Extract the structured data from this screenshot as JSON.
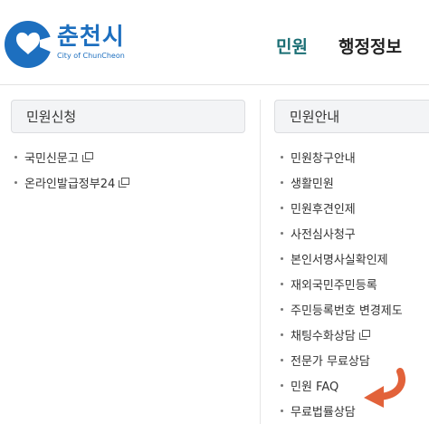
{
  "header": {
    "logo_name": "춘천시",
    "logo_sub": "City of ChunCheon",
    "nav": [
      {
        "label": "민원"
      },
      {
        "label": "행정정보"
      }
    ]
  },
  "left_column": {
    "title": "민원신청",
    "items": [
      {
        "label": "국민신문고",
        "external": true
      },
      {
        "label": "온라인발급정부24",
        "external": true
      }
    ]
  },
  "right_column": {
    "title": "민원안내",
    "items": [
      {
        "label": "민원창구안내",
        "external": false
      },
      {
        "label": "생활민원",
        "external": false
      },
      {
        "label": "민원후견인제",
        "external": false
      },
      {
        "label": "사전심사청구",
        "external": false
      },
      {
        "label": "본인서명사실확인제",
        "external": false
      },
      {
        "label": "재외국민주민등록",
        "external": false
      },
      {
        "label": "주민등록번호 변경제도",
        "external": false
      },
      {
        "label": "채팅수화상담",
        "external": true
      },
      {
        "label": "전문가 무료상담",
        "external": false
      },
      {
        "label": "민원 FAQ",
        "external": false
      },
      {
        "label": "무료법률상담",
        "external": false
      }
    ]
  },
  "colors": {
    "brand": "#1d6fbf",
    "nav_active": "#1a6e74",
    "arrow": "#e2623a"
  },
  "icons": {
    "external": "new-window-icon",
    "pointer": "curved-arrow-icon"
  }
}
